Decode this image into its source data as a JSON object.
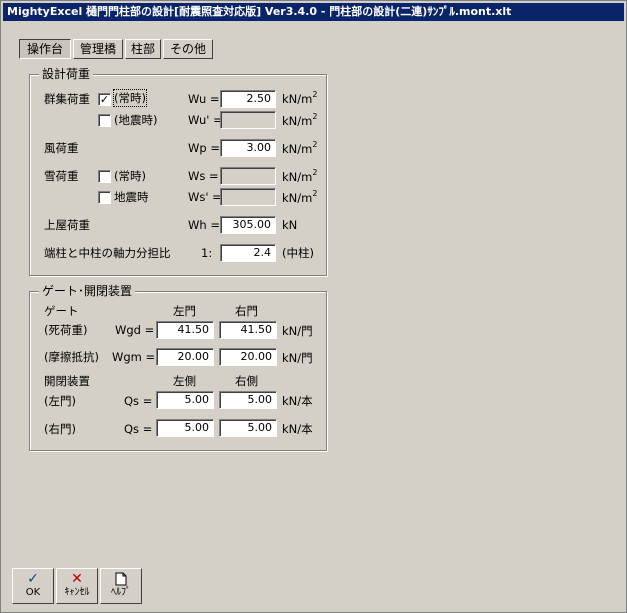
{
  "title": "MightyExcel 樋門門柱部の設計[耐震照査対応版] Ver3.4.0 - 門柱部の設計(二連)ｻﾝﾌﾟﾙ.mont.xlt",
  "tabs": [
    {
      "label": "操作台",
      "active": true
    },
    {
      "label": "管理橋",
      "active": false
    },
    {
      "label": "柱部",
      "active": false
    },
    {
      "label": "その他",
      "active": false
    }
  ],
  "design_load": {
    "legend": "設計荷重",
    "crowd_label": "群集荷重",
    "crowd_normal": {
      "label": "(常時)",
      "checked": true,
      "var": "Wu =",
      "value": "2.50",
      "unit": "kN/m",
      "sup": "2"
    },
    "crowd_quake": {
      "label": "(地震時)",
      "checked": false,
      "var": "Wu' =",
      "value": "",
      "unit": "kN/m",
      "sup": "2"
    },
    "wind": {
      "label": "風荷重",
      "var": "Wp =",
      "value": "3.00",
      "unit": "kN/m",
      "sup": "2"
    },
    "snow_label": "雪荷重",
    "snow_normal": {
      "label": "(常時)",
      "checked": false,
      "var": "Ws =",
      "value": "",
      "unit": "kN/m",
      "sup": "2"
    },
    "snow_quake": {
      "label": "地震時",
      "checked": false,
      "var": "Ws' =",
      "value": "",
      "unit": "kN/m",
      "sup": "2"
    },
    "roof": {
      "label": "上屋荷重",
      "var": "Wh =",
      "value": "305.00",
      "unit": "kN"
    },
    "ratio": {
      "label": "端柱と中柱の軸力分担比",
      "var": "1:",
      "value": "2.4",
      "unit": "(中柱)"
    }
  },
  "gate": {
    "legend": "ゲート･開閉装置",
    "gate_label": "ゲート",
    "col_left": "左門",
    "col_right": "右門",
    "dead": {
      "label": "(死荷重)",
      "var": "Wgd =",
      "left": "41.50",
      "right": "41.50",
      "unit": "kN/門"
    },
    "friction": {
      "label": "(摩擦抵抗)",
      "var": "Wgm =",
      "left": "20.00",
      "right": "20.00",
      "unit": "kN/門"
    },
    "device_label": "開閉装置",
    "col_left_side": "左側",
    "col_right_side": "右側",
    "left_gate": {
      "label": "(左門)",
      "var": "Qs =",
      "left": "5.00",
      "right": "5.00",
      "unit": "kN/本"
    },
    "right_gate": {
      "label": "(右門)",
      "var": "Qs =",
      "left": "5.00",
      "right": "5.00",
      "unit": "kN/本"
    }
  },
  "buttons": {
    "ok": "OK",
    "cancel": "ｷｬﾝｾﾙ",
    "help": "ﾍﾙﾌﾟ"
  },
  "colors": {
    "titlebar": "#0a246a",
    "face": "#d4d0c8",
    "ok_icon": "#1c3c8c",
    "cancel_icon": "#c00000"
  }
}
